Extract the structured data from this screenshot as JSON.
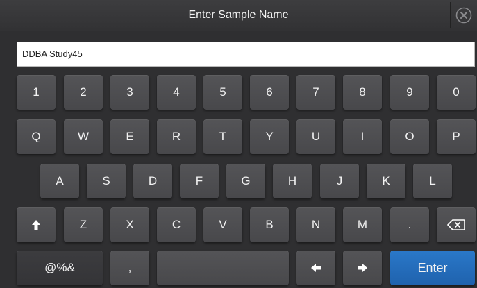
{
  "header": {
    "title": "Enter Sample Name"
  },
  "icons": {
    "close": "close-circle-icon",
    "shift": "arrow-up-icon",
    "backspace": "backspace-icon",
    "left": "arrow-left-icon",
    "right": "arrow-right-icon"
  },
  "input": {
    "value": "DDBA Study45"
  },
  "keyboard": {
    "row1": [
      "1",
      "2",
      "3",
      "4",
      "5",
      "6",
      "7",
      "8",
      "9",
      "0"
    ],
    "row2": [
      "Q",
      "W",
      "E",
      "R",
      "T",
      "Y",
      "U",
      "I",
      "O",
      "P"
    ],
    "row3": [
      "A",
      "S",
      "D",
      "F",
      "G",
      "H",
      "J",
      "K",
      "L"
    ],
    "row4": [
      "Z",
      "X",
      "C",
      "V",
      "B",
      "N",
      "M",
      "."
    ],
    "symbols_label": "@%&",
    "comma_label": ",",
    "enter_label": "Enter"
  },
  "colors": {
    "accent": "#2a78c9",
    "key": "#4f4f52",
    "background": "#2f2f31"
  }
}
